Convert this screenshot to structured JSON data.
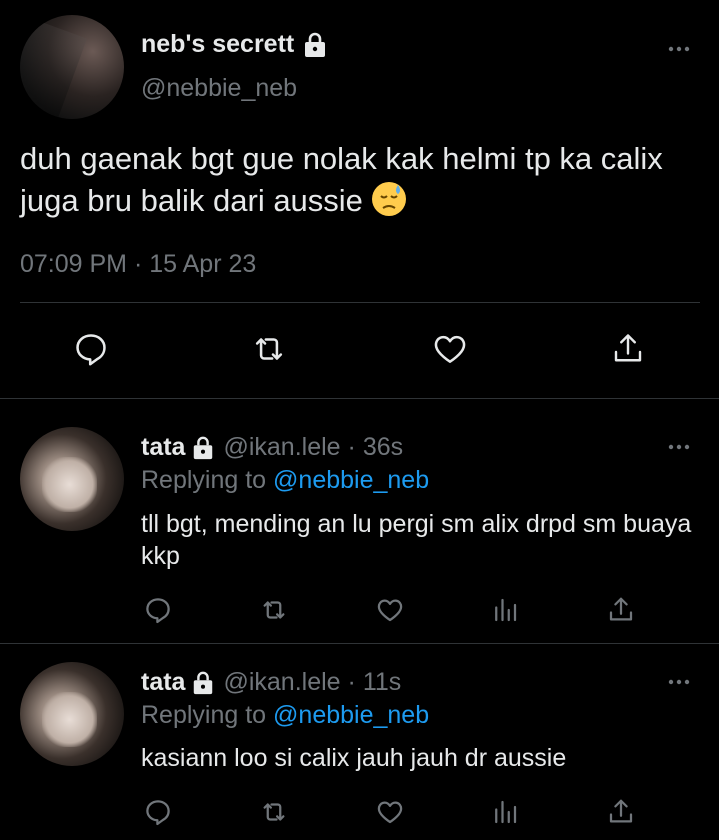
{
  "main_tweet": {
    "display_name": "neb's secrett",
    "handle": "@nebbie_neb",
    "text": "duh gaenak bgt gue nolak kak helmi tp ka calix juga bru balik dari aussie",
    "emoji": "downcast-face-with-sweat",
    "time": "07:09 PM",
    "separator": "·",
    "date": "15 Apr 23"
  },
  "replies": [
    {
      "display_name": "tata",
      "handle": "@ikan.lele",
      "separator": "·",
      "age": "36s",
      "replying_prefix": "Replying to",
      "replying_to": "@nebbie_neb",
      "text": "tll bgt, mending an lu pergi sm alix drpd sm buaya kkp"
    },
    {
      "display_name": "tata",
      "handle": "@ikan.lele",
      "separator": "·",
      "age": "11s",
      "replying_prefix": "Replying to",
      "replying_to": "@nebbie_neb",
      "text": "kasiann loo si calix jauh jauh dr aussie"
    }
  ],
  "colors": {
    "background": "#000000",
    "text": "#e7e9ea",
    "muted": "#71767b",
    "link": "#1d9bf0",
    "divider": "#2f3336"
  },
  "icons": [
    "lock-icon",
    "more-icon",
    "reply-icon",
    "retweet-icon",
    "like-icon",
    "views-icon",
    "share-icon"
  ]
}
